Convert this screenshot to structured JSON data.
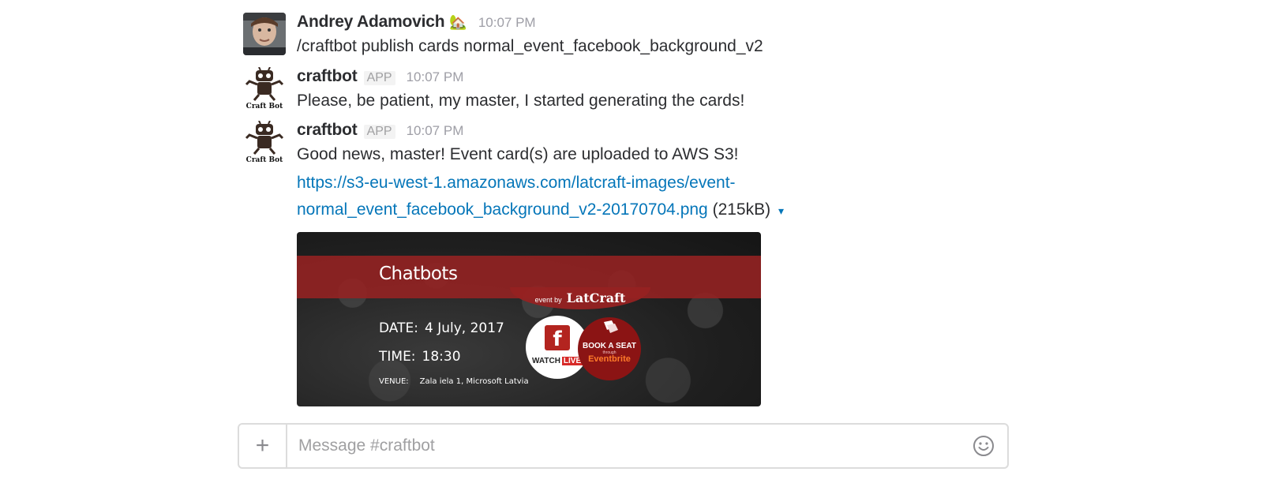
{
  "messages": [
    {
      "author": "Andrey Adamovich",
      "status_emoji": "🏡",
      "time": "10:07 PM",
      "text": "/craftbot publish cards normal_event_facebook_background_v2"
    },
    {
      "author": "craftbot",
      "badge": "APP",
      "time": "10:07 PM",
      "avatar_caption": "Craft Bot",
      "text": "Please, be patient, my master, I started generating the cards!"
    },
    {
      "author": "craftbot",
      "badge": "APP",
      "time": "10:07 PM",
      "avatar_caption": "Craft Bot",
      "text": "Good news, master! Event card(s) are uploaded to AWS S3!",
      "link_line1": "https://s3-eu-west-1.amazonaws.com/latcraft-images/event-",
      "link_line2": "normal_event_facebook_background_v2-20170704.png",
      "file_size": "(215kB)",
      "caret_icon": "▾"
    }
  ],
  "card": {
    "title": "Chatbots",
    "event_by_label": "event by",
    "event_by_brand": "LatCraft",
    "date_label": "DATE:",
    "date_value": "4 July, 2017",
    "time_label": "TIME:",
    "time_value": "18:30",
    "venue_label": "VENUE:",
    "venue_value": "Zala iela 1, Microsoft Latvia",
    "watch_label": "WATCH",
    "live_label": "LIVE",
    "book_label": "BOOK A SEAT",
    "through_label": "through",
    "eventbrite_label": "Eventbrite",
    "fb_glyph": "f"
  },
  "composer": {
    "placeholder": "Message #craftbot",
    "plus_icon": "+"
  },
  "colors": {
    "link": "#0576b9",
    "banner": "#962222",
    "text": "#2c2d30",
    "muted": "#9e9ea6"
  }
}
